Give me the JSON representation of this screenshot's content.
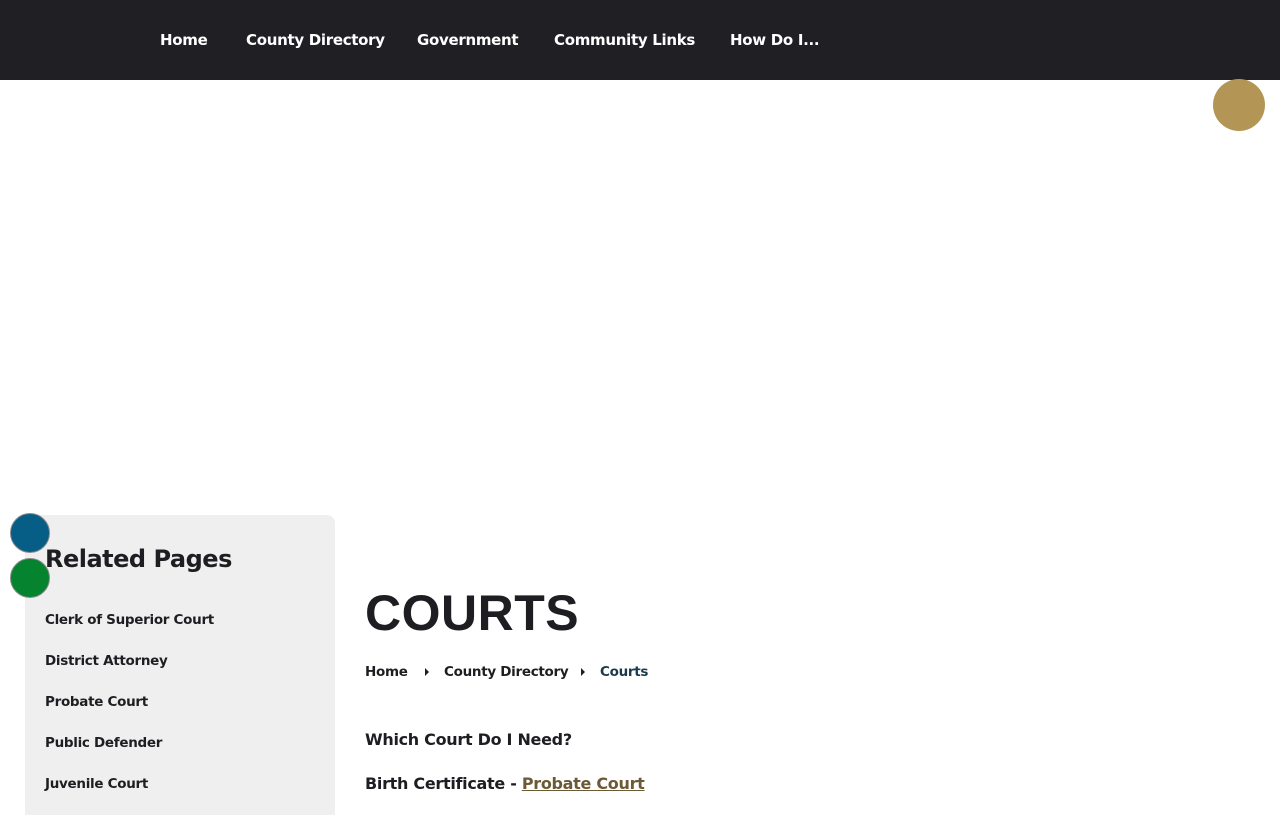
{
  "nav": {
    "items": [
      {
        "label": "Home"
      },
      {
        "label": "County Directory"
      },
      {
        "label": "Government"
      },
      {
        "label": "Community Links"
      },
      {
        "label": "How Do I..."
      }
    ]
  },
  "sidebar": {
    "title": "Related Pages",
    "links": [
      {
        "label": "Clerk of Superior Court"
      },
      {
        "label": "District Attorney"
      },
      {
        "label": "Probate Court"
      },
      {
        "label": "Public Defender"
      },
      {
        "label": "Juvenile Court"
      }
    ]
  },
  "main": {
    "title": "COURTS",
    "breadcrumb": [
      {
        "label": "Home"
      },
      {
        "label": "County Directory"
      },
      {
        "label": "Courts"
      }
    ],
    "question": "Which Court Do I Need?",
    "lines": [
      {
        "prefix": "Birth Certificate - ",
        "link": "Probate Court"
      }
    ]
  },
  "colors": {
    "nav_background": "#202024",
    "gold_accent": "#b39556",
    "blue_circle": "#065e86",
    "green_circle": "#05832f",
    "sidebar_background": "#efefef",
    "link_color": "#6b5a35"
  }
}
